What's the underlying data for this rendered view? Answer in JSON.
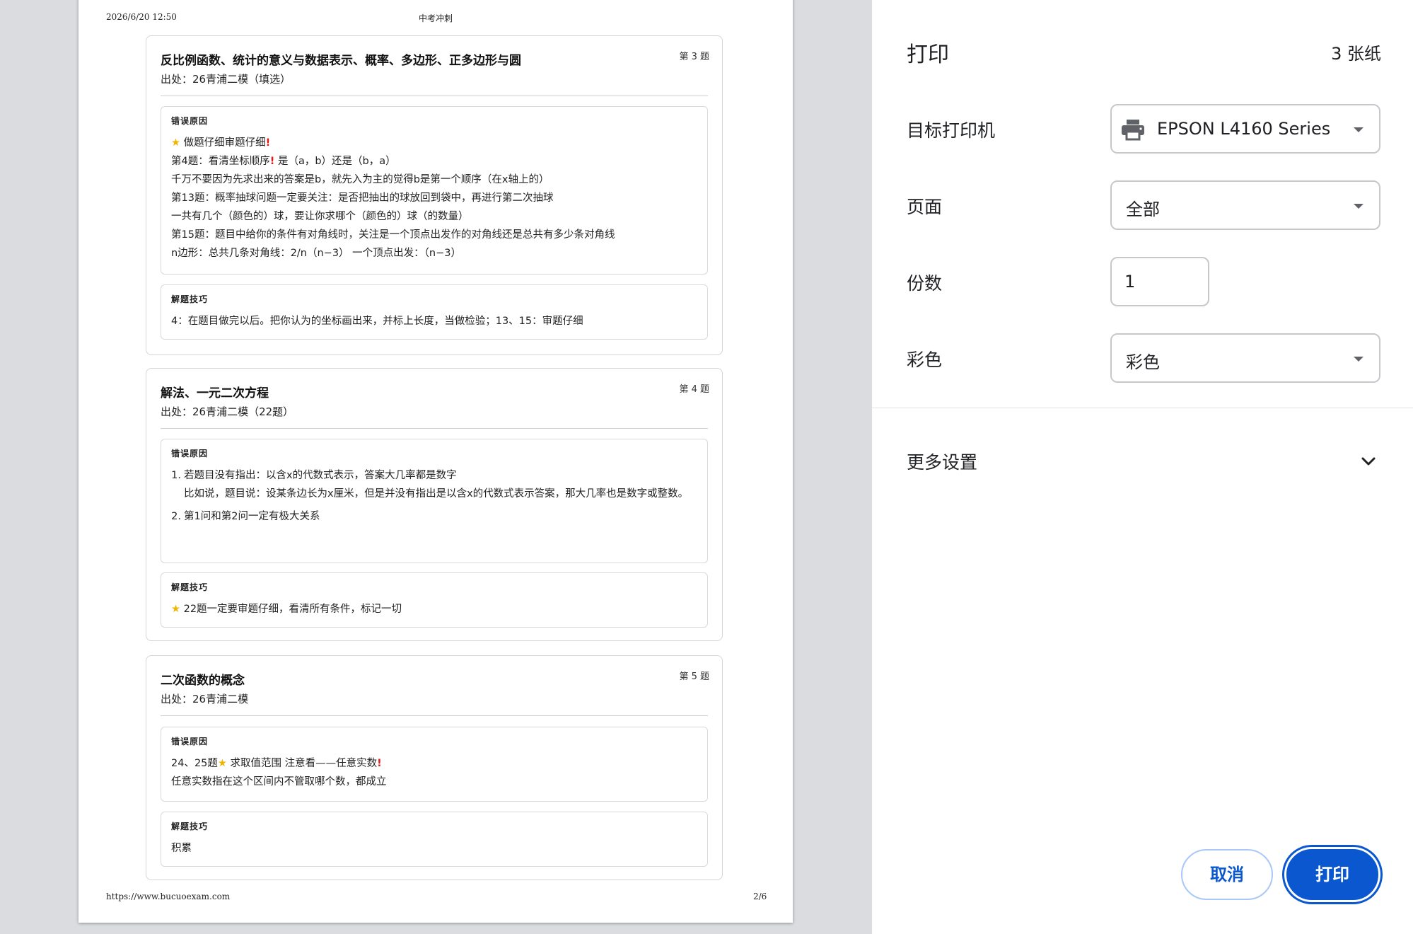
{
  "page": {
    "header_date": "2026/6/20 12:50",
    "header_title": "中考冲刺",
    "footer_url": "https://www.bucuoexam.com",
    "footer_page": "2/6"
  },
  "cards": [
    {
      "title": "反比例函数、统计的意义与数据表示、概率、多边形、正多边形与圆",
      "number": "第 3 题",
      "source": "出处：26青浦二模（填选）",
      "reason_label": "错误原因",
      "reason_lines": [
        "做题仔细审题仔细",
        "第4题：看清坐标顺序",
        "是（a，b）还是（b，a）",
        "千万不要因为先求出来的答案是b，就先入为主的觉得b是第一个顺序（在x轴上的）",
        "第13题：概率抽球问题一定要关注：是否把抽出的球放回到袋中，再进行第二次抽球",
        "一共有几个（颜色的）球，要让你求哪个（颜色的）球（的数量）",
        "第15题：题目中给你的条件有对角线时，关注是一个顶点出发作的对角线还是总共有多少条对角线",
        "n边形：总共几条对角线：2/n（n−3）  一个顶点出发：（n−3）"
      ],
      "tip_label": "解题技巧",
      "tip_text": "4：在题目做完以后。把你认为的坐标画出来，并标上长度，当做检验；13、15：审题仔细"
    },
    {
      "title": "解法、一元二次方程",
      "number": "第 4 题",
      "source": "出处：26青浦二模（22题）",
      "reason_label": "错误原因",
      "reason_items": [
        {
          "num": "1.",
          "lines": [
            "若题目没有指出：以含x的代数式表示，答案大几率都是数字",
            "比如说，题目说：设某条边长为x厘米，但是并没有指出是以含x的代数式表示答案，那大几率也是数字或整数。"
          ]
        },
        {
          "num": "2.",
          "lines": [
            "第1问和第2问一定有极大关系"
          ]
        }
      ],
      "tip_label": "解题技巧",
      "tip_text": "22题一定要审题仔细，看清所有条件，标记一切"
    },
    {
      "title": "二次函数的概念",
      "number": "第 5 题",
      "source": "出处：26青浦二模",
      "reason_label": "错误原因",
      "reason_lines": [
        "24、25题",
        "求取值范围 注意看——任意实数",
        "任意实数指在这个区间内不管取哪个数，都成立"
      ],
      "tip_label": "解题技巧",
      "tip_text": "积累"
    }
  ],
  "print": {
    "title": "打印",
    "sheets": "3 张纸",
    "printer_label": "目标打印机",
    "printer_value": "EPSON L4160 Series",
    "pages_label": "页面",
    "pages_value": "全部",
    "copies_label": "份数",
    "copies_value": "1",
    "color_label": "彩色",
    "color_value": "彩色",
    "more_settings": "更多设置",
    "cancel": "取消",
    "print": "打印"
  },
  "icons": {
    "star": "star-icon",
    "exclamation": "exclamation-icon",
    "printer": "printer-icon",
    "chevron": "chevron-down-icon"
  },
  "colors": {
    "accent": "#0b57d0",
    "star": "#f0b400",
    "exclamation": "#e01818"
  }
}
